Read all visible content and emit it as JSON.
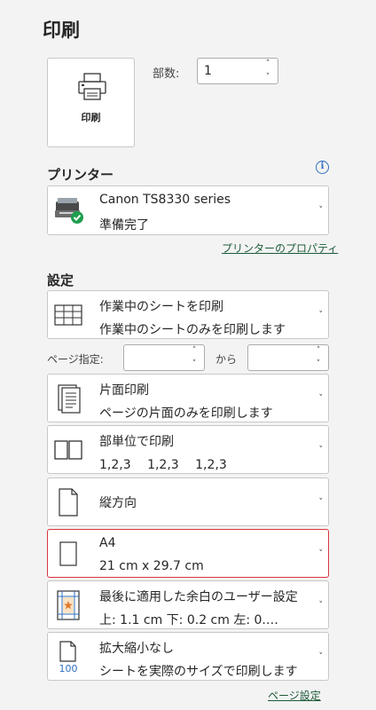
{
  "title": "印刷",
  "print_button": {
    "label": "印刷"
  },
  "copies": {
    "label": "部数:",
    "value": "1"
  },
  "printer_section": {
    "heading": "プリンター",
    "printer": {
      "name": "Canon TS8330 series",
      "status": "準備完了"
    },
    "properties_link": "プリンターのプロパティ"
  },
  "settings_section": {
    "heading": "設定",
    "print_what": {
      "line1": "作業中のシートを印刷",
      "line2": "作業中のシートのみを印刷します"
    },
    "pages": {
      "label": "ページ指定:",
      "from_value": "",
      "to_label": "から",
      "to_value": ""
    },
    "sides": {
      "line1": "片面印刷",
      "line2": "ページの片面のみを印刷します"
    },
    "collate": {
      "line1": "部単位で印刷",
      "line2": "1,2,3　 1,2,3　 1,2,3"
    },
    "orientation": {
      "label": "縦方向"
    },
    "paper": {
      "line1": "A4",
      "line2": "21 cm x 29.7 cm"
    },
    "margins": {
      "line1": "最後に適用した余白のユーザー設定",
      "line2": "上: 1.1 cm 下: 0.2 cm 左: 0.…"
    },
    "scaling": {
      "line1": "拡大縮小なし",
      "line2": "シートを実際のサイズで印刷します",
      "icon_text": "100"
    },
    "page_setup_link": "ページ設定"
  },
  "colors": {
    "accent_red": "#d9363e",
    "link_green": "#1e5c3a",
    "info_blue": "#2f6fbe",
    "check_green": "#1f9e4f"
  }
}
